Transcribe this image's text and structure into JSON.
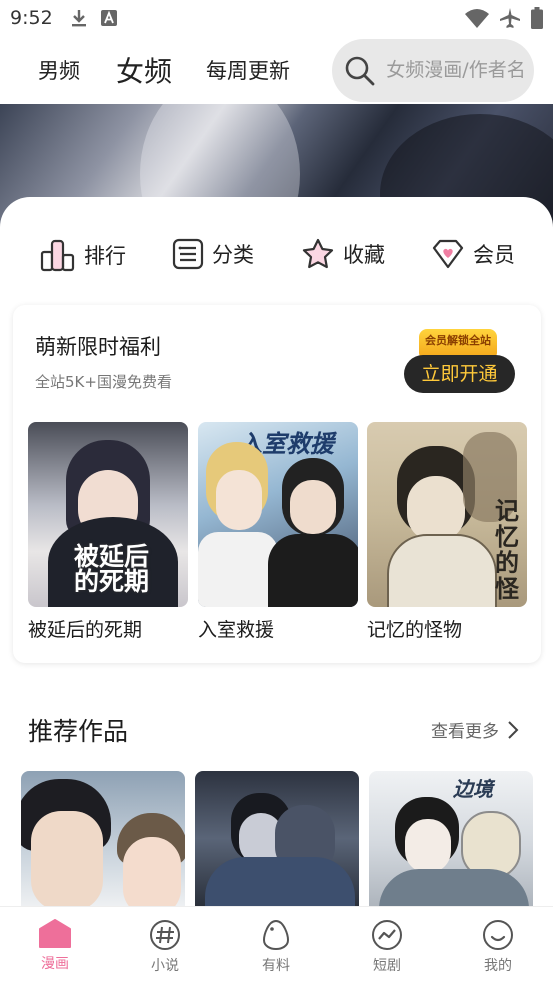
{
  "status_bar": {
    "time": "9:52",
    "icons_left": [
      "download-icon",
      "font-a-icon"
    ],
    "icons_right": [
      "wifi-icon",
      "airplane-mode-icon",
      "battery-icon"
    ]
  },
  "nav": {
    "tabs": [
      {
        "label": "男频",
        "active": false
      },
      {
        "label": "女频",
        "active": true
      },
      {
        "label": "每周更新",
        "active": false
      }
    ],
    "search_placeholder": "女频漫画/作者名"
  },
  "quick_links": [
    {
      "label": "排行",
      "icon": "bar-chart-icon"
    },
    {
      "label": "分类",
      "icon": "list-icon"
    },
    {
      "label": "收藏",
      "icon": "star-icon"
    },
    {
      "label": "会员",
      "icon": "diamond-heart-icon"
    }
  ],
  "promo": {
    "title": "萌新限时福利",
    "subtitle": "全站5K+国漫免费看",
    "badge": "会员解锁全站",
    "button": "立即开通",
    "books": [
      {
        "title": "被延后的死期",
        "cover_text": "被延后的死期"
      },
      {
        "title": "入室救援",
        "cover_text": "入室救援"
      },
      {
        "title": "记忆的怪物",
        "cover_text": "记忆的怪"
      }
    ]
  },
  "recommended": {
    "title": "推荐作品",
    "more_label": "查看更多",
    "cover_texts": [
      "",
      "",
      "边境"
    ]
  },
  "bottom_tabs": [
    {
      "label": "漫画",
      "icon": "home-comic-icon",
      "active": true
    },
    {
      "label": "小说",
      "icon": "hash-icon",
      "active": false
    },
    {
      "label": "有料",
      "icon": "egg-icon",
      "active": false
    },
    {
      "label": "短剧",
      "icon": "trend-icon",
      "active": false
    },
    {
      "label": "我的",
      "icon": "smile-icon",
      "active": false
    }
  ],
  "colors": {
    "accent_pink": "#ee6f9a",
    "promo_button_bg": "#272727",
    "promo_button_text": "#ffc93a"
  }
}
